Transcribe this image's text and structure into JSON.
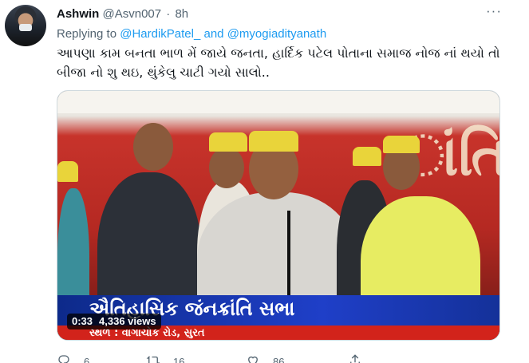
{
  "tweet": {
    "author_name": "Ashwin",
    "author_handle": "@Asvn007",
    "separator": "·",
    "time": "8h",
    "more_icon": "ellipsis-icon",
    "replying_prefix": "Replying to",
    "replying_to_1": "@HardikPatel_",
    "replying_and": "and",
    "replying_to_2": "@myogiadityanath",
    "text_line_1": "આપણા કામ બનતા ભાળ મેં જાયે જનતા, હાર્દિક પટેલ પોતાના સમાજ નોજ નાં થયો તો",
    "text_line_2": "બીજા નો શુ થઇ, થુંકેલુ ચાટી ગયો સાલો..",
    "media": {
      "overlay_title": "ઐતિહાસિક જંનક્રાંતિ સભા",
      "overlay_subtitle": "સ્થળ : વાગાચોક રોડ, સુરત",
      "banner_text": "ાંતિ",
      "video_time": "0:33",
      "view_count": "4,336 views"
    },
    "actions": {
      "reply_count": "6",
      "retweet_count": "16",
      "like_count": "86"
    }
  },
  "colors": {
    "accent": "#1d9bf0",
    "secondary_text": "#536471",
    "primary_text": "#0f1419"
  }
}
